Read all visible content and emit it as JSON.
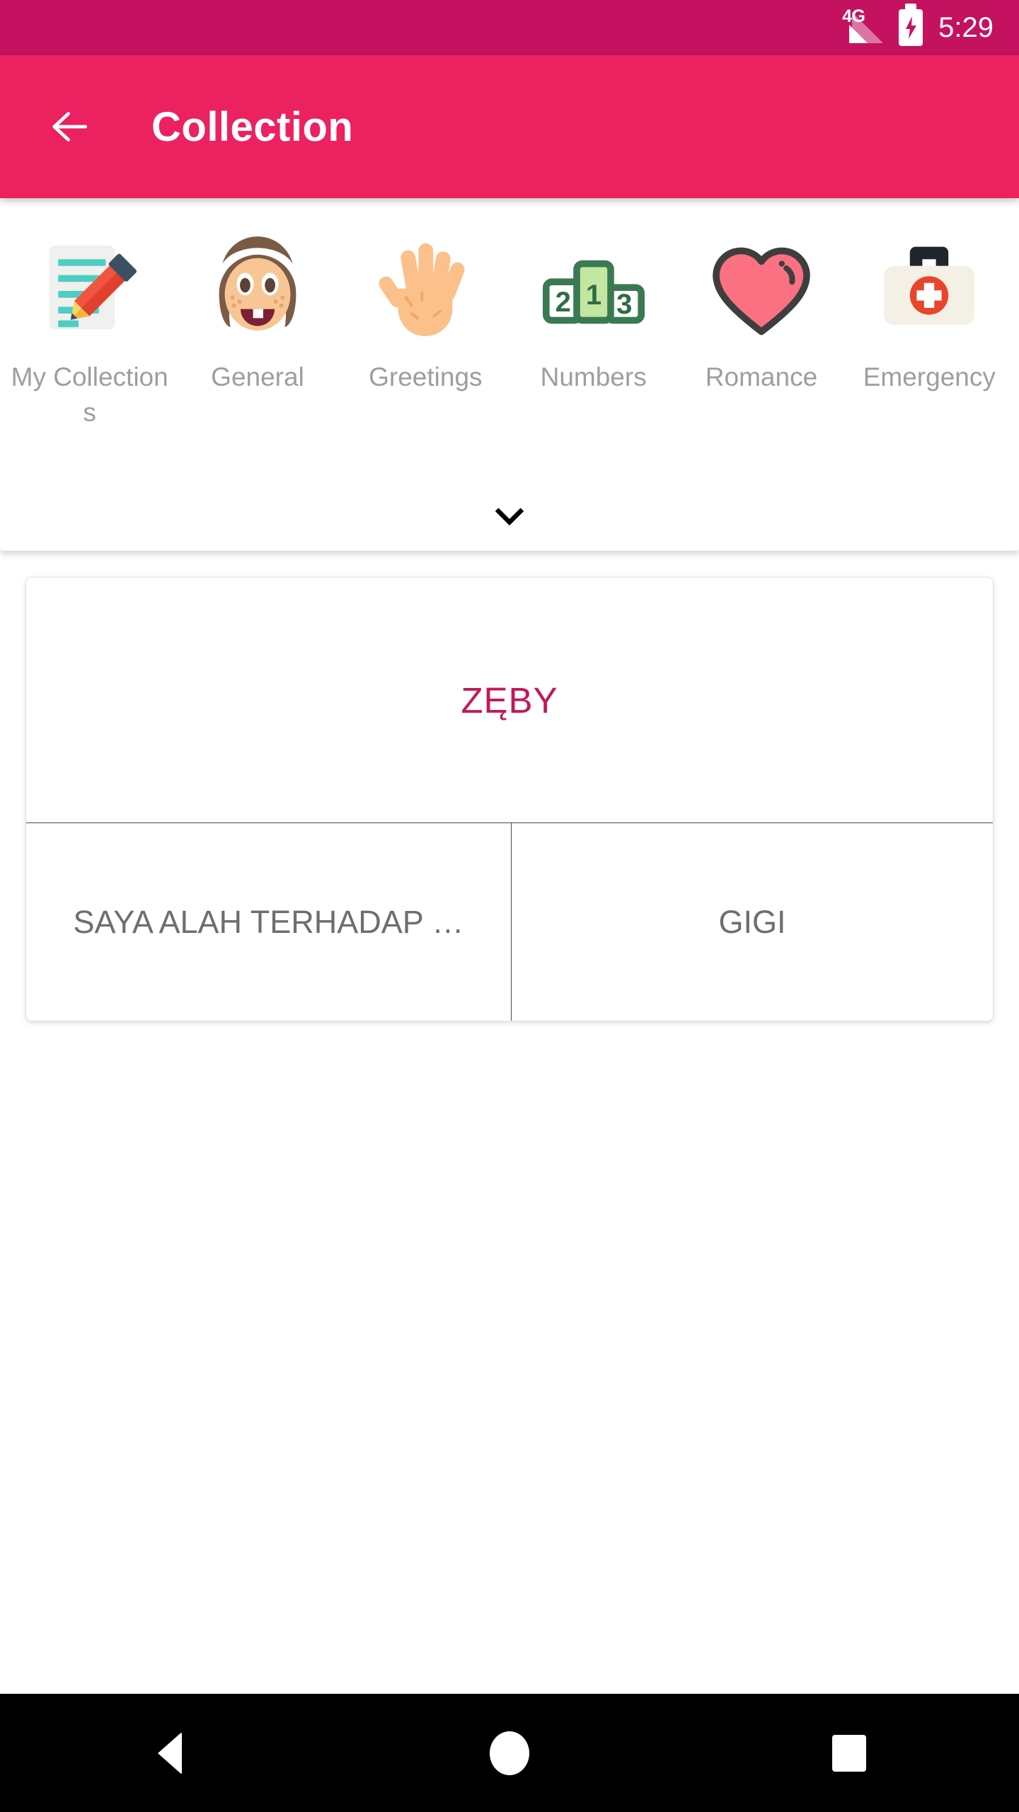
{
  "status_bar": {
    "network_type": "4G",
    "battery_icon": "battery-charging-icon",
    "signal_icon": "signal-bars-icon",
    "time": "5:29",
    "background_color": "#C41260"
  },
  "app_bar": {
    "back_icon": "arrow-back-icon",
    "title": "Collection",
    "background_color": "#EC2160",
    "title_color": "#FFFFFF"
  },
  "categories": {
    "expand_icon": "chevron-down-icon",
    "items": [
      {
        "label": "My Collections",
        "icon": "memo-pencil-icon"
      },
      {
        "label": "General",
        "icon": "girl-face-icon"
      },
      {
        "label": "Greetings",
        "icon": "raised-hand-icon"
      },
      {
        "label": "Numbers",
        "icon": "podium-123-icon"
      },
      {
        "label": "Romance",
        "icon": "heart-icon"
      },
      {
        "label": "Emergency",
        "icon": "medical-bag-icon"
      }
    ],
    "label_color": "#9E9E9E"
  },
  "entry_card": {
    "headword": "ZĘBY",
    "headword_color": "#C2185B",
    "translation_left": "SAYA ALAH TERHADAP …",
    "translation_right": "GIGI",
    "translation_color": "#6E6E6E"
  },
  "nav_bar": {
    "back": "nav-back-icon",
    "home": "nav-home-icon",
    "recents": "nav-recents-icon",
    "background_color": "#000000"
  }
}
